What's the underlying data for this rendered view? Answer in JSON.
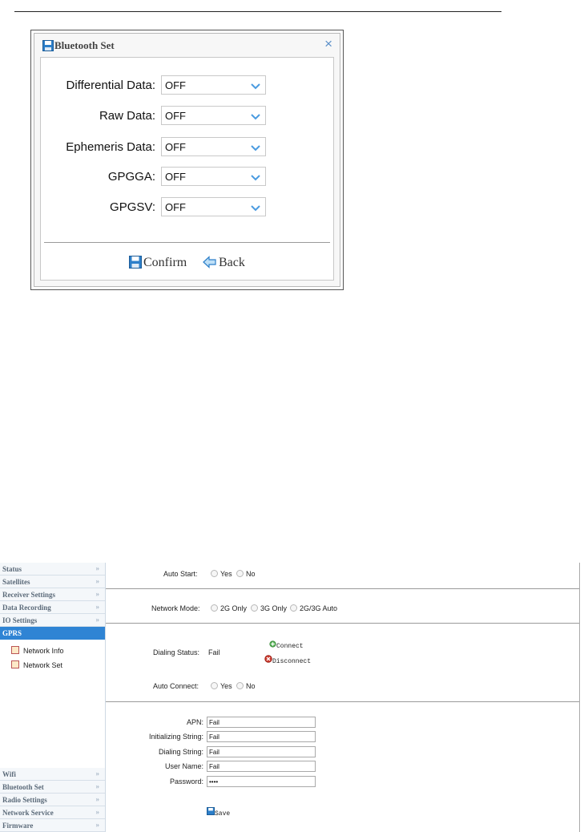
{
  "bluetooth_dialog": {
    "title": "Bluetooth Set",
    "close": "×",
    "fields": [
      {
        "label": "Differential Data:",
        "value": "OFF"
      },
      {
        "label": "Raw Data:",
        "value": "OFF"
      },
      {
        "label": "Ephemeris Data:",
        "value": "OFF"
      },
      {
        "label": "GPGGA:",
        "value": "OFF"
      },
      {
        "label": "GPGSV:",
        "value": "OFF"
      }
    ],
    "confirm_label": "Confirm",
    "back_label": "Back"
  },
  "sidebar": {
    "items_top": [
      "Status",
      "Satellites",
      "Receiver Settings",
      "Data Recording",
      "IO Settings"
    ],
    "active": "GPRS",
    "sub_items": [
      "Network Info",
      "Network Set"
    ],
    "items_bottom": [
      "Wifi",
      "Bluetooth Set",
      "Radio Settings",
      "Network Service",
      "Firmware"
    ],
    "expand_glyph": "»"
  },
  "gprs": {
    "auto_start_label": "Auto Start:",
    "yes": "Yes",
    "no": "No",
    "network_mode_label": "Network Mode:",
    "modes": [
      "2G Only",
      "3G Only",
      "2G/3G Auto"
    ],
    "dialing_status_label": "Dialing Status:",
    "dialing_status_value": "Fail",
    "connect_label": "Connect",
    "disconnect_label": "Disconnect",
    "auto_connect_label": "Auto Connect:",
    "fields": [
      {
        "label": "APN:",
        "value": "Fail"
      },
      {
        "label": "Initializing String:",
        "value": "Fail"
      },
      {
        "label": "Dialing String:",
        "value": "Fail"
      },
      {
        "label": "User Name:",
        "value": "Fail"
      },
      {
        "label": "Password:",
        "value": "••••"
      }
    ],
    "save_label": "Save"
  },
  "colors": {
    "accent": "#2f84d4",
    "chevron": "#4a9be0"
  }
}
